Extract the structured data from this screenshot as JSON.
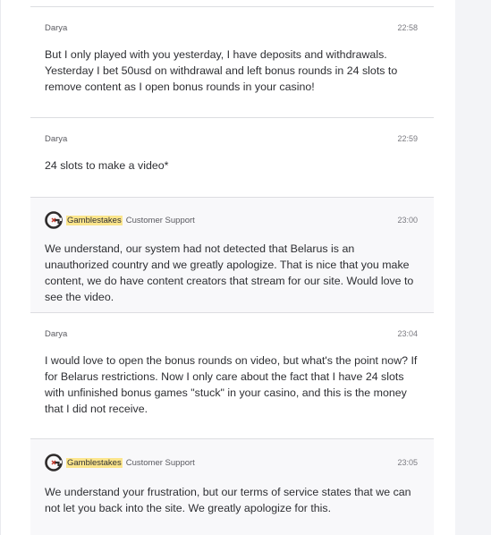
{
  "messages": [
    {
      "author": "Darya",
      "time": "22:58",
      "text": "But I only played with you yesterday, I have deposits and withdrawals. Yesterday I bet 50usd on withdrawal and left bonus rounds in 24 slots to remove content as I open bonus rounds in your casino!"
    },
    {
      "author": "Darya",
      "time": "22:59",
      "text": "24 slots to make a video*"
    },
    {
      "brand": "Gamblestakes",
      "role": "Customer Support",
      "time": "23:00",
      "text": "We understand, our system had not detected that Belarus is an unauthorized country and we greatly apologize. That is nice that you make content, we do have content creators that stream for our site. Would love to see the video."
    },
    {
      "author": "Darya",
      "time": "23:04",
      "text": "I would love to open the bonus rounds on video, but what's the point now? If for Belarus restrictions. Now I only care about the fact that I have 24 slots with unfinished bonus games \"stuck\" in your casino, and this is the money that I did not receive."
    },
    {
      "brand": "Gamblestakes",
      "role": "Customer Support",
      "time": "23:05",
      "text": "We understand your frustration, but our terms of service states that we can not let you back into the site. We greatly apologize for this."
    }
  ],
  "colors": {
    "brand_highlight": "#fbe58c",
    "agent_background": "#f8f8fa",
    "divider": "#dcdde1"
  },
  "icons": {
    "agent_avatar": "gamblestakes-logo-icon"
  }
}
